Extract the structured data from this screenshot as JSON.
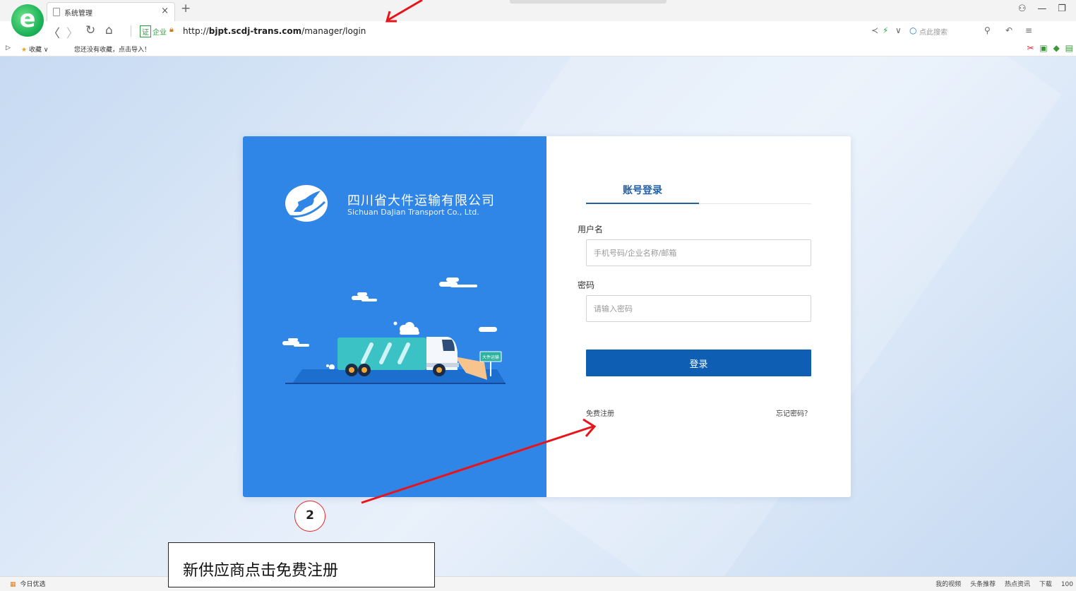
{
  "browser": {
    "tab_title": "系统管理",
    "tab_close": "×",
    "new_tab": "+",
    "url_prefix": "http://",
    "url_host": "bjpt.scdj-trans.com",
    "url_path": "/manager/login",
    "cert_badge": "证",
    "cert_label": "企业",
    "search_hint": "点此搜索",
    "window_controls": [
      "⚇",
      "—",
      "❐"
    ],
    "nav": {
      "back": "〈",
      "forward": "〉",
      "refresh": "↻",
      "home": "⌂"
    }
  },
  "favbar": {
    "favorites_label": "收藏",
    "import_hint": "您还没有收藏，点击导入！"
  },
  "brand": {
    "name_cn": "四川省大件运输有限公司",
    "name_en": "Sichuan DaJian Transport Co., Ltd.",
    "truck_sign": "大件运输"
  },
  "login": {
    "tab_label": "账号登录",
    "username_label": "用户名",
    "username_placeholder": "手机号码/企业名称/邮箱",
    "password_label": "密码",
    "password_placeholder": "请输入密码",
    "submit_label": "登录",
    "register_label": "免费注册",
    "forgot_label": "忘记密码？"
  },
  "annotation": {
    "step_number": "2",
    "caption": "新供应商点击免费注册",
    "arrow_color": "#e8141a"
  },
  "statusbar": {
    "left_label": "今日优选",
    "items": [
      "我的视频",
      "头条推荐",
      "热点资讯",
      "下载",
      "100"
    ]
  },
  "colors": {
    "brand_blue": "#2f86e6",
    "button_blue": "#0e5fb4",
    "tab_active": "#1f5fa8"
  }
}
